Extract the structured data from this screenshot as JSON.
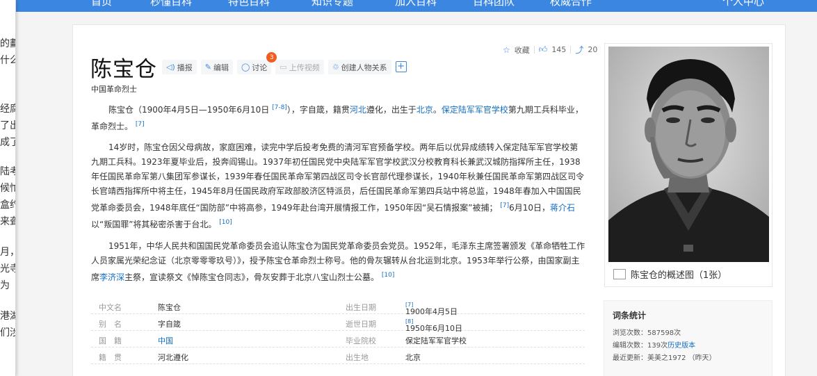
{
  "left_strip": {
    "chars": [
      "的劃",
      "什么",
      "经腐",
      "了出",
      "成了",
      "陆考",
      "候忙",
      "盒约",
      "来聋",
      "月，",
      "光寺",
      "为",
      "港湖",
      "们涉"
    ]
  },
  "nav": {
    "items": [
      "首页",
      "秒懂百科",
      "特色百科",
      "知识专题",
      "加入百科",
      "百科团队",
      "权威合作",
      "个人中心"
    ]
  },
  "entry": {
    "title": "陈宝仓",
    "subtitle": "中国革命烈士",
    "tools": {
      "report": "播报",
      "edit": "编辑",
      "discuss": "讨论",
      "discuss_count": "3",
      "upload_video": "上传视频",
      "create_relation": "创建人物关系"
    },
    "actions": {
      "favorite": "收藏",
      "likes": "145",
      "shares": "20"
    }
  },
  "paragraphs": {
    "p1": {
      "t1": "陈宝仓（1900年4月5日—1950年6月10日 ",
      "ref1": "[7-8]",
      "t2": "），字自箴，籍贯",
      "l1": "河北",
      "t3": "遵化，出生于",
      "l2": "北京",
      "t4": "。",
      "l3": "保定陆军军官学校",
      "t5": "第九期工兵科毕业，革命烈士。",
      "ref2": "[7]"
    },
    "p2": {
      "t1": "14岁时，陈宝仓因父母病故，家庭困难，读完中学后投考免费的清河军官预备学校。两年后以优异成绩转入保定陆军军官学校第九期工兵科。1923年夏毕业后，投奔阎锡山。1937年初任国民党中央陆军军官学校武汉分校教育科长兼武汉城防指挥所主任，1938年任国民革命军第八集团军参谋长，1939年春任国民革命军第四战区司令长官部代理参谋长，1940年秋兼任国民革命军第四战区司令长官靖西指挥所中将主任，1945年8月任国民政府军政部胶济区特派员，后任国民革命军第四兵站中将总监，1948年春加入中国国民党革命委员会，1948年底任“国防部”中将高参，1949年赴台湾开展情报工作，1950年因“吴石情报案”被捕；",
      "ref1": "[7]",
      "t2": "6月10日，",
      "l1": "蒋介石",
      "t3": "以“叛国罪”将其秘密杀害于台北。",
      "ref2": "[10]"
    },
    "p3": {
      "t1": "1951年，中华人民共和国国民党革命委员会追认陈宝仓为国民党革命委员会党员。1952年，毛泽东主席签署颁发《革命牺牲工作人员家属光荣纪念证（北京零零零玖号）》，授予陈宝仓革命烈士称号。他的骨灰辗转从台北运到北京。1953年举行公祭，由国家副主席",
      "l1": "李济深",
      "t2": "主祭，宣读祭文《悼陈宝仓同志》，骨灰安葬于北京八宝山烈士公墓。",
      "ref1": "[10]"
    }
  },
  "info_table": {
    "rows": [
      {
        "k1": "中文名",
        "v1": "陈宝仓",
        "k2": "出生日期",
        "v2": "1900年4月5日",
        "r2": "[7]"
      },
      {
        "k1": "别　名",
        "v1": "字自箴",
        "k2": "逝世日期",
        "v2": "1950年6月10日",
        "r2": "[8]"
      },
      {
        "k1": "国　籍",
        "v1": "中国",
        "k2": "毕业院校",
        "v2": "保定陆军军官学校",
        "r2": ""
      },
      {
        "k1": "籍　贯",
        "v1": "河北遵化",
        "k2": "出生地",
        "v2": "北京",
        "r2": ""
      }
    ]
  },
  "portrait": {
    "caption": "陈宝仓的概述图（1张）"
  },
  "stats": {
    "title": "词条统计",
    "views_label": "浏览次数：",
    "views": "587598次",
    "edits_label": "编辑次数：",
    "edits": "139次",
    "history_link": "历史版本",
    "updated_label": "最近更新：",
    "updated": "美美之1972 （昨天）"
  }
}
